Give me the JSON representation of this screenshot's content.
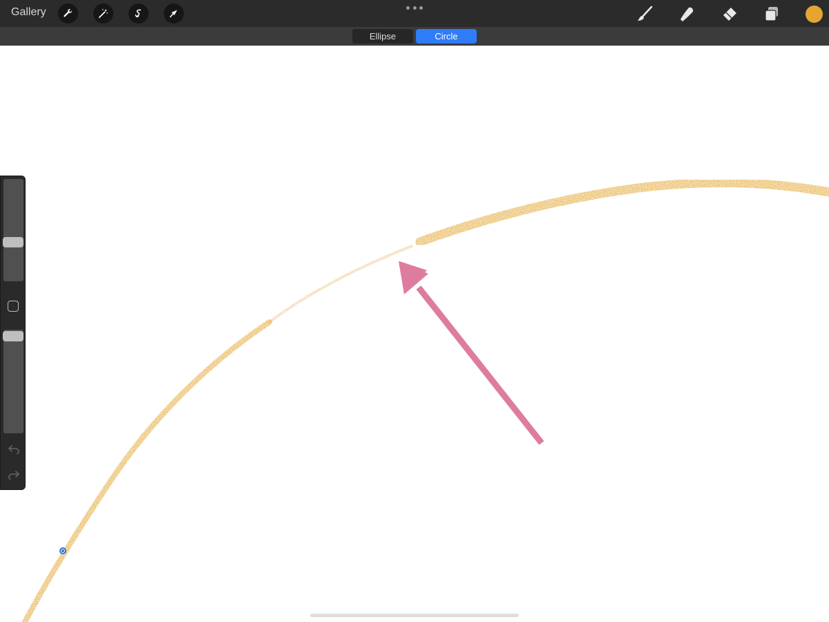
{
  "topbar": {
    "gallery_label": "Gallery",
    "left_tools": [
      "wrench-icon",
      "magic-wand-icon",
      "selection-icon",
      "transform-arrow-icon"
    ],
    "right_tools": [
      "brush-icon",
      "smudge-icon",
      "eraser-icon",
      "layers-icon"
    ],
    "current_color": "#e4a631"
  },
  "shape_options": {
    "ellipse_label": "Ellipse",
    "circle_label": "Circle",
    "selected": "Circle",
    "selected_color": "#2f7cf6"
  },
  "canvas": {
    "stroke_color": "#e4a631",
    "annotation_arrow_color": "#de7ca0"
  },
  "sidebar": {
    "size_slider_value": 0.6,
    "opacity_slider_value": 0.97
  }
}
